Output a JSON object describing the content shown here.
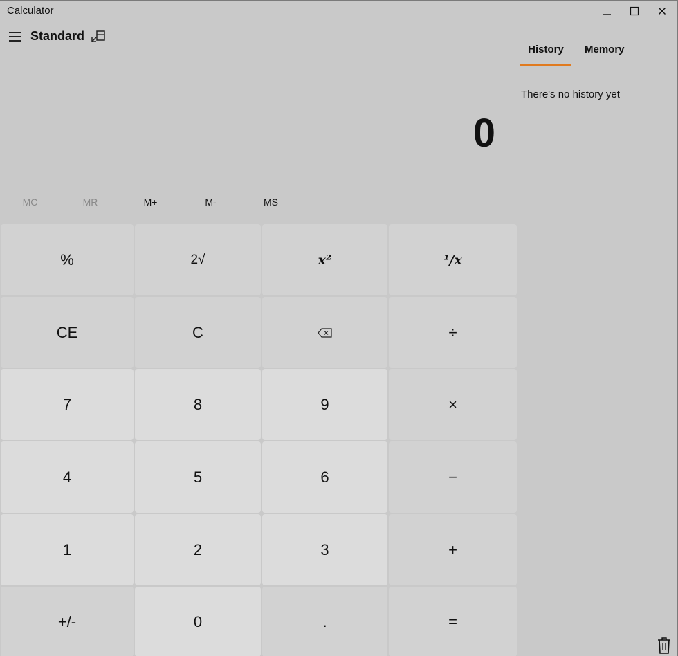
{
  "window": {
    "title": "Calculator",
    "minimize_icon": "minimize-icon",
    "maximize_icon": "maximize-icon",
    "close_icon": "close-icon"
  },
  "header": {
    "mode": "Standard",
    "menu_icon": "hamburger-menu-icon",
    "keep_on_top_icon": "keep-on-top-icon"
  },
  "display": {
    "value": "0"
  },
  "memory": {
    "buttons": [
      {
        "label": "MC",
        "enabled": false
      },
      {
        "label": "MR",
        "enabled": false
      },
      {
        "label": "M+",
        "enabled": true
      },
      {
        "label": "M-",
        "enabled": true
      },
      {
        "label": "MS",
        "enabled": true
      }
    ]
  },
  "keypad": {
    "rows": [
      [
        "%",
        "2√",
        "x²",
        "¹/x"
      ],
      [
        "CE",
        "C",
        "⌫",
        "÷"
      ],
      [
        "7",
        "8",
        "9",
        "×"
      ],
      [
        "4",
        "5",
        "6",
        "−"
      ],
      [
        "1",
        "2",
        "3",
        "+"
      ],
      [
        "+/-",
        "0",
        ".",
        "="
      ]
    ]
  },
  "panel": {
    "tabs": [
      {
        "label": "History",
        "active": true
      },
      {
        "label": "Memory",
        "active": false
      }
    ],
    "empty_message": "There's no history yet",
    "delete_icon": "trash-icon",
    "accent_color": "#e07a1f"
  }
}
